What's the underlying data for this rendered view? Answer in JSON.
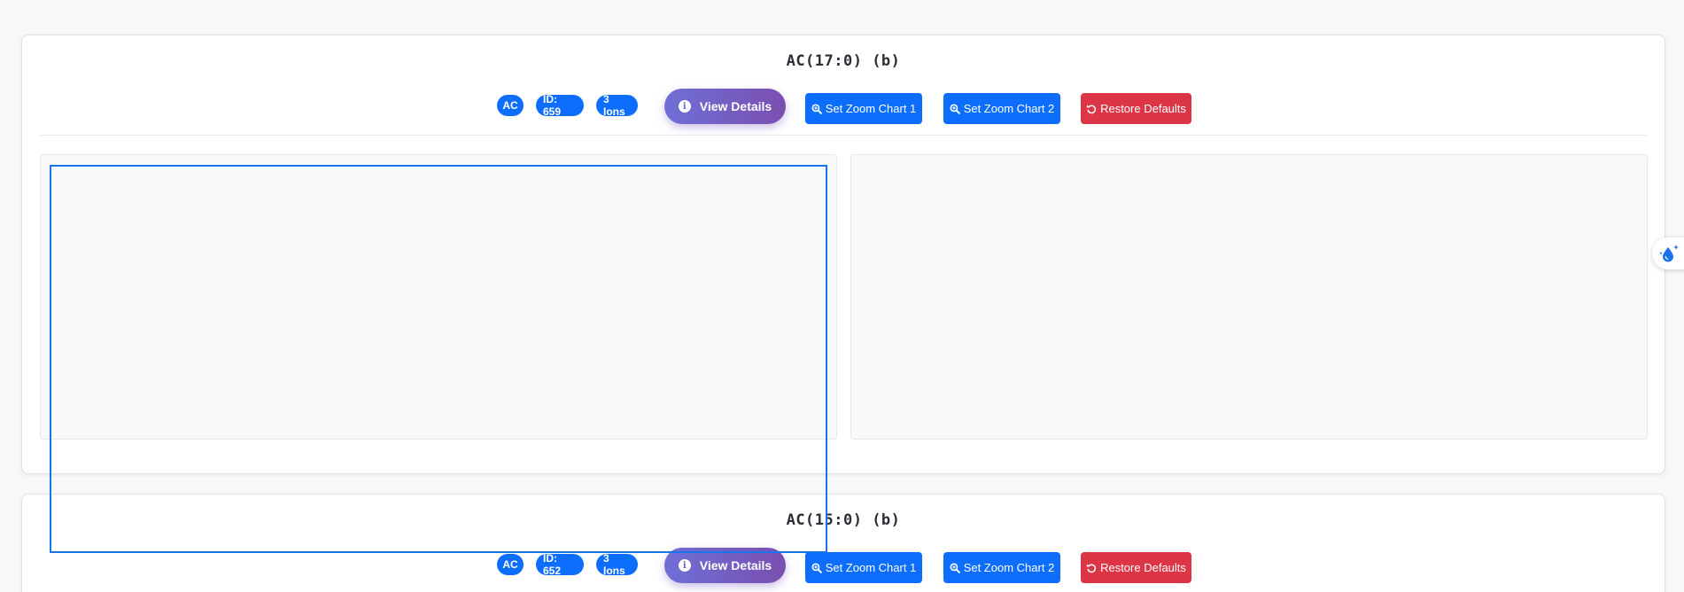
{
  "cards": [
    {
      "title": "AC(17:0) (b)",
      "badges": {
        "type": "AC",
        "id": "ID: 659",
        "ions": "3 Ions"
      },
      "view_details_label": "View Details",
      "zoom1_label": "Set Zoom Chart 1",
      "zoom2_label": "Set Zoom Chart 2",
      "restore_label": "Restore Defaults"
    },
    {
      "title": "AC(15:0) (b)",
      "badges": {
        "type": "AC",
        "id": "ID: 652",
        "ions": "3 Ions"
      },
      "view_details_label": "View Details",
      "zoom1_label": "Set Zoom Chart 1",
      "zoom2_label": "Set Zoom Chart 2",
      "restore_label": "Restore Defaults"
    }
  ],
  "icons": {
    "info": "info-icon",
    "zoom": "search-plus-icon",
    "restore": "undo-icon",
    "side_widget": "droplet-sparkle-icon"
  },
  "colors": {
    "primary": "#0d6efd",
    "danger": "#dc3545",
    "gradient_start": "#6f6fd6",
    "gradient_end": "#7a4fb0",
    "zoom_box": "#1a73e8"
  }
}
